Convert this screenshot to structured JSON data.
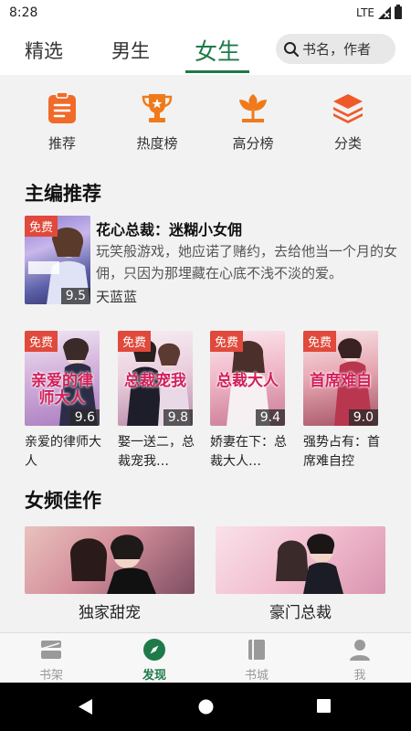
{
  "status_bar": {
    "time": "8:28",
    "network": "LTE"
  },
  "top_tabs": [
    {
      "label": "精选"
    },
    {
      "label": "男生"
    },
    {
      "label": "女生"
    }
  ],
  "search": {
    "placeholder": "书名，作者"
  },
  "categories": [
    {
      "label": "推荐",
      "icon": "clipboard-list-icon",
      "color": "#f06a2a"
    },
    {
      "label": "热度榜",
      "icon": "trophy-icon",
      "color": "#f07a1a"
    },
    {
      "label": "高分榜",
      "icon": "flower-icon",
      "color": "#f07a1a"
    },
    {
      "label": "分类",
      "icon": "layers-icon",
      "color": "#ef5a2a"
    }
  ],
  "editor_picks": {
    "title": "主编推荐",
    "featured": {
      "badge": "免费",
      "score": "9.5",
      "title": "花心总裁：迷糊小女佣",
      "description": "玩笑般游戏，她应诺了赌约，去给他当一个月的女佣，只因为那埋藏在心底不浅不淡的爱。",
      "author": "天蓝蓝"
    },
    "books": [
      {
        "badge": "免费",
        "score": "9.6",
        "cover_text": "亲爱的律师大人",
        "title": "亲爱的律师大人"
      },
      {
        "badge": "免费",
        "score": "9.8",
        "cover_text": "总裁宠我",
        "title": "娶一送二，总裁宠我…"
      },
      {
        "badge": "免费",
        "score": "9.4",
        "cover_text": "总裁大人",
        "title": "娇妻在下：总裁大人…"
      },
      {
        "badge": "免费",
        "score": "9.0",
        "cover_text": "首席难自",
        "title": "强势占有：首席难自控"
      }
    ]
  },
  "female_picks": {
    "title": "女频佳作",
    "banners": [
      {
        "label": "独家甜宠"
      },
      {
        "label": "豪门总裁"
      }
    ]
  },
  "bottom_nav": [
    {
      "label": "书架",
      "icon": "bookshelf-icon"
    },
    {
      "label": "发现",
      "icon": "compass-icon",
      "active": true
    },
    {
      "label": "书城",
      "icon": "book-icon"
    },
    {
      "label": "我",
      "icon": "person-icon"
    }
  ],
  "colors": {
    "accent": "#1f7a4a",
    "badge": "#e0493b"
  }
}
